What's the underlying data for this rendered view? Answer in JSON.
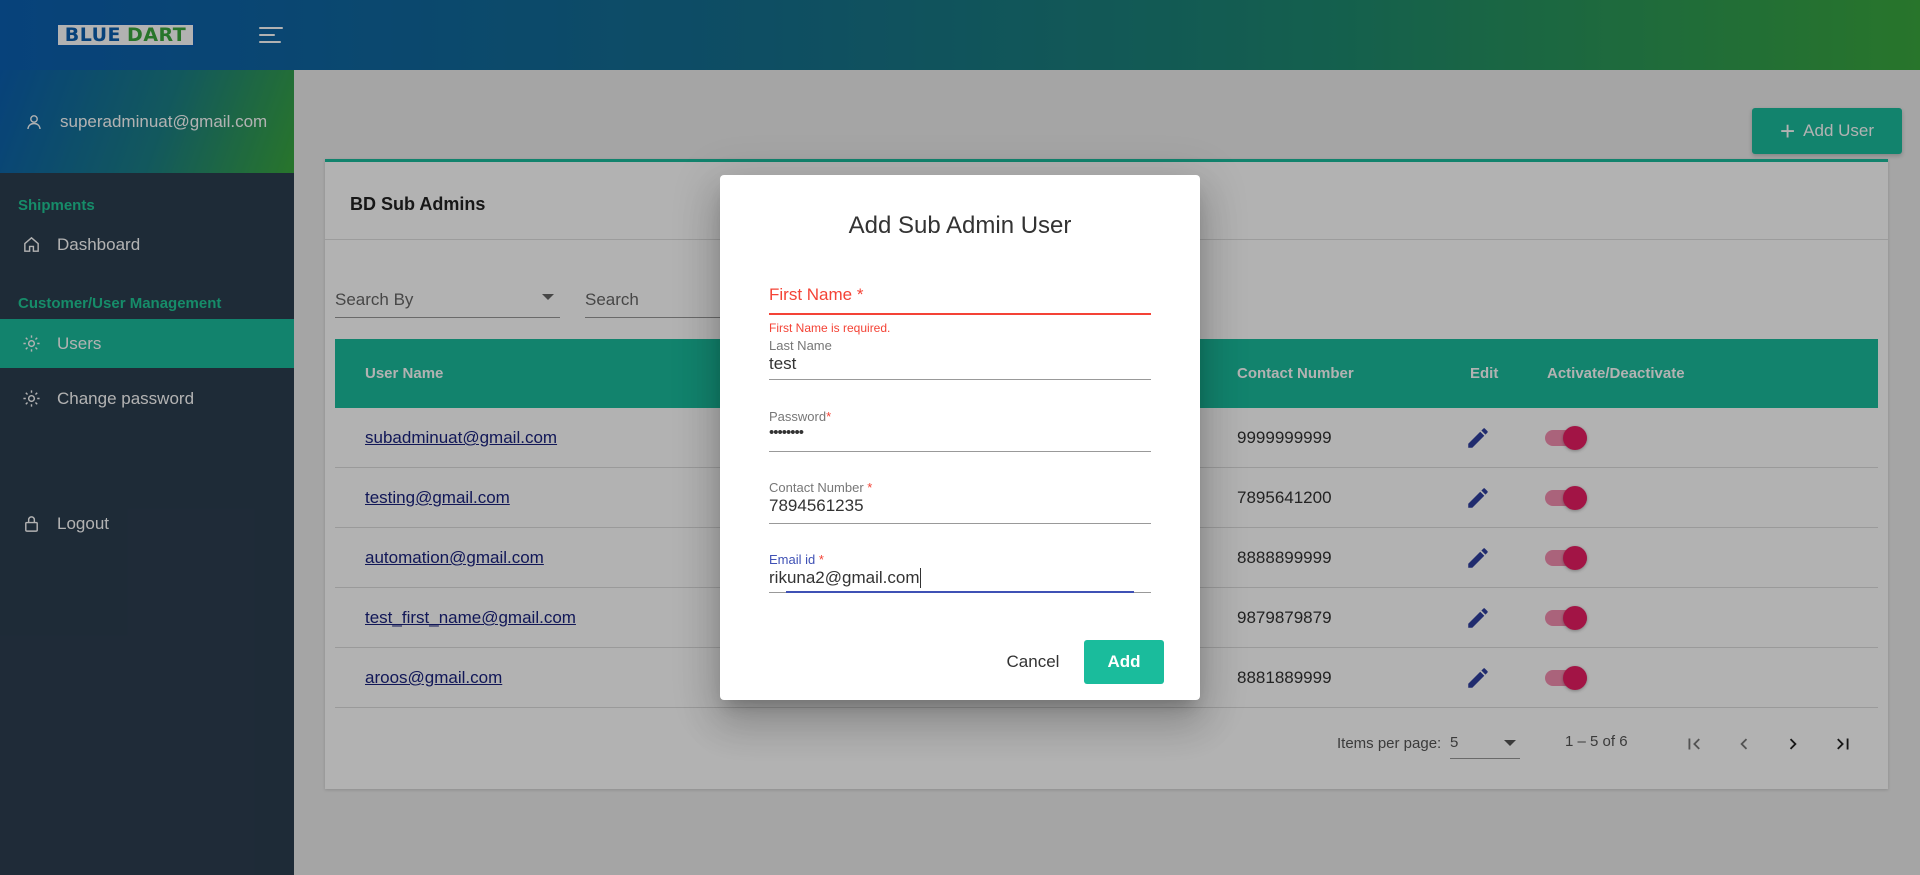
{
  "header": {
    "logo_primary": "BLUE",
    "logo_secondary": "DART",
    "brand_colors": {
      "blue": "#0b5fb0",
      "green": "#3aa83e"
    }
  },
  "sidebar": {
    "user_email": "superadminuat@gmail.com",
    "sections": [
      {
        "title": "Shipments"
      },
      {
        "title": "Customer/User Management"
      }
    ],
    "items": [
      {
        "label": "Dashboard",
        "icon": "home-icon"
      },
      {
        "label": "Users",
        "icon": "gear-icon"
      },
      {
        "label": "Change password",
        "icon": "gear-icon"
      },
      {
        "label": "Logout",
        "icon": "lock-icon"
      }
    ],
    "colors": {
      "background": "#2c3e50",
      "accent": "#1abc9c",
      "section_title": "#20c997"
    }
  },
  "main": {
    "add_user_label": "Add User",
    "card_title": "BD Sub Admins",
    "search_by_placeholder": "Search By",
    "search_placeholder": "Search",
    "columns": [
      "User Name",
      "Contact Number",
      "Edit",
      "Activate/Deactivate"
    ],
    "rows": [
      {
        "email": "subadminuat@gmail.com",
        "contact": "9999999999",
        "active": true
      },
      {
        "email": "testing@gmail.com",
        "contact": "7895641200",
        "active": true
      },
      {
        "email": "automation@gmail.com",
        "contact": "8888899999",
        "active": true
      },
      {
        "email": "test_first_name@gmail.com",
        "contact": "9879879879",
        "active": true
      },
      {
        "email": "aroos@gmail.com",
        "contact": "8881889999",
        "active": true
      }
    ],
    "paginator": {
      "items_per_page_label": "Items per page:",
      "items_per_page_value": "5",
      "range_label": "1 – 5 of 6"
    }
  },
  "dialog": {
    "title": "Add Sub Admin User",
    "first_name": {
      "label": "First Name",
      "required_mark": "*",
      "value": "",
      "error": "First Name is required."
    },
    "last_name": {
      "label": "Last Name",
      "value": "test"
    },
    "password": {
      "label": "Password",
      "required_mark": "*",
      "value": "••••••••"
    },
    "contact_number": {
      "label": "Contact Number",
      "required_mark": "*",
      "value": "7894561235"
    },
    "email": {
      "label": "Email id",
      "required_mark": "*",
      "value": "rikuna2@gmail.com"
    },
    "cancel_label": "Cancel",
    "add_label": "Add",
    "colors": {
      "error": "#f44336",
      "focus": "#3f51b5",
      "primary": "#1abc9c"
    }
  }
}
